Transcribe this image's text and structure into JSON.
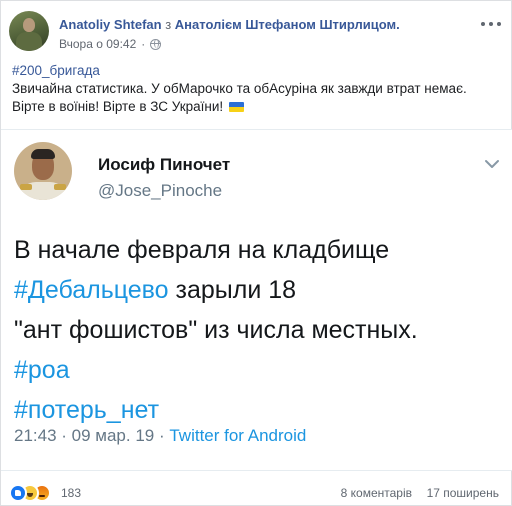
{
  "post": {
    "author": "Anatoliy Shtefan",
    "with_word": "з",
    "tagged": "Анатолієм Штефаном Штирлицом.",
    "time": "Вчора о 09:42",
    "hashtag": "#200_бригада",
    "text_line1": "Звичайна статистика. У обМарочко та обАсуріна як завжди втрат немає.",
    "text_line2": "Вірте в воїнів! Вірте в ЗС України!",
    "icons": {
      "privacy": "globe-icon",
      "menu": "more-icon",
      "flag": "ukraine-flag-icon"
    }
  },
  "tweet": {
    "display_name": "Иосиф Пиночет",
    "handle": "@Jose_Pinoche",
    "line1": "В начале февраля на кладбище",
    "line2_hashtag": "#Дебальцево",
    "line2_rest": " зарыли 18",
    "line3": "\"ант фошистов\" из числа местных.",
    "hashtag_roa": "#роа",
    "hashtag_losses": "#потерь_нет",
    "meta_time": "21:43 · 09 мар. 19 · ",
    "source": "Twitter for Android",
    "icons": {
      "menu": "chevron-down-icon"
    }
  },
  "footer": {
    "reaction_count": "183",
    "comments": "8 коментарів",
    "shares": "17 поширень",
    "icons": [
      "like-icon",
      "haha-icon",
      "angry-icon"
    ]
  },
  "colors": {
    "fb_link": "#385898",
    "twitter_blue": "#1b95e0",
    "secondary_text": "#616770",
    "like_blue": "#1877f2"
  }
}
